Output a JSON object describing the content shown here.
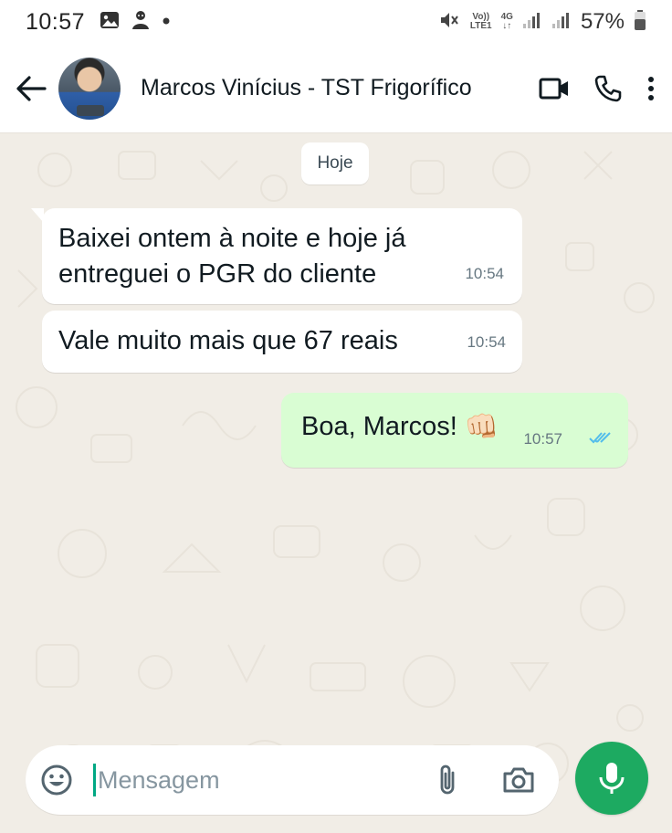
{
  "status_bar": {
    "time": "10:57",
    "network_top": "Vo))",
    "network_bottom": "LTE1",
    "network_type": "4G",
    "battery": "57%",
    "icons": [
      "image-icon",
      "person-hoodie-icon",
      "dot-icon",
      "mute-icon",
      "signal-icon",
      "signal-icon",
      "battery-icon"
    ]
  },
  "header": {
    "contact_name": "Marcos Vinícius - TST Frigorífico",
    "icons": [
      "back-arrow-icon",
      "avatar",
      "video-call-icon",
      "phone-icon",
      "more-vert-icon"
    ]
  },
  "chat": {
    "date_chip": "Hoje",
    "messages": [
      {
        "direction": "incoming",
        "text_line1": "Baixei ontem à noite e hoje já",
        "text_line2": "entreguei o PGR do cliente",
        "time": "10:54"
      },
      {
        "direction": "incoming",
        "text": "Vale muito mais que 67 reais",
        "time": "10:54"
      },
      {
        "direction": "outgoing",
        "text": "Boa, Marcos!",
        "emoji": "👊🏻",
        "time": "10:57",
        "status": "read"
      }
    ]
  },
  "input": {
    "placeholder": "Mensagem",
    "value": ""
  },
  "colors": {
    "outgoing_bubble": "#d9fdd3",
    "incoming_bubble": "#ffffff",
    "chat_bg": "#f1ede6",
    "accent": "#1daa61",
    "read_ticks": "#53bdeb"
  }
}
